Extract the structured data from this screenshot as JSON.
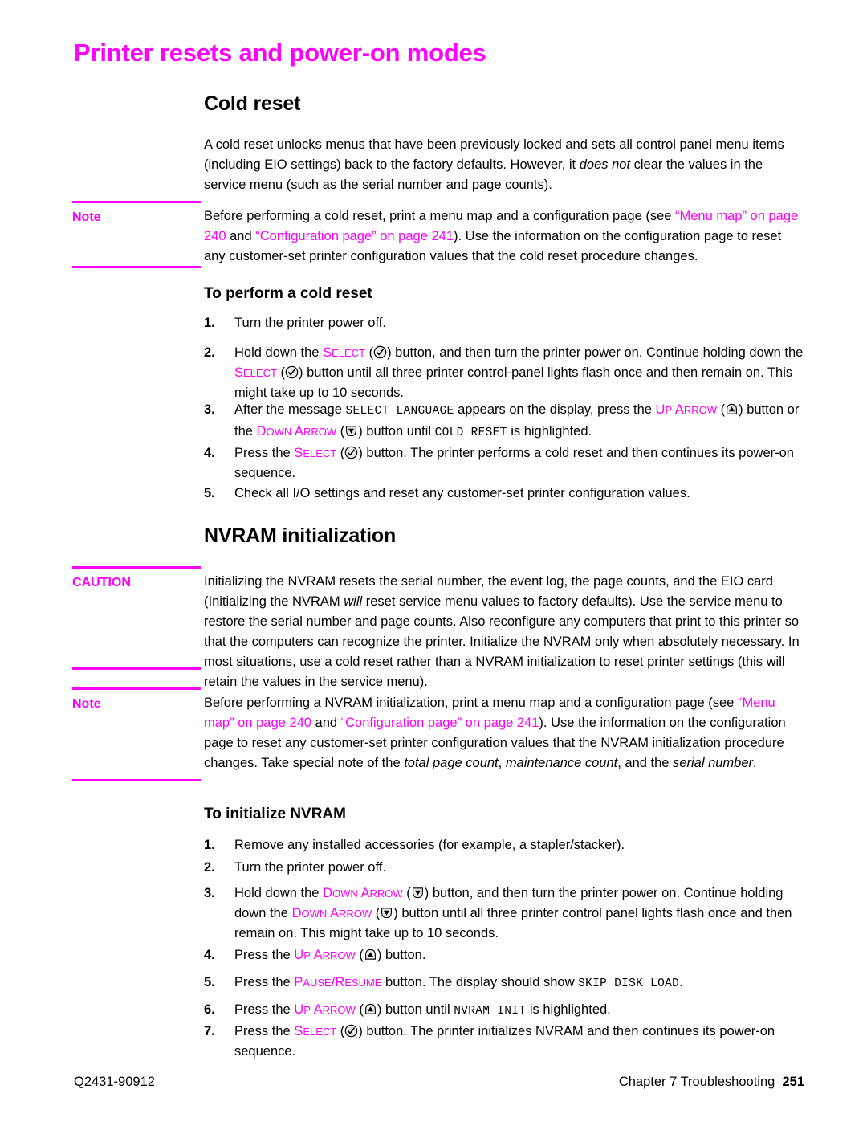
{
  "page": {
    "title": "Printer resets and power-on modes",
    "accent_color": "#ff00ff",
    "text_color": "#000000",
    "background_color": "#ffffff"
  },
  "sections": {
    "cold_reset": {
      "heading": "Cold reset",
      "intro_1": "A cold reset unlocks menus that have been previously locked and sets all control panel menu items (including EIO settings) back to the factory defaults. However, it ",
      "intro_italic": "does not",
      "intro_2": " clear the values in the service menu (such as the serial number and page counts).",
      "note": {
        "label": "Note",
        "t1": "Before performing a cold reset, print a menu map and a configuration page (see ",
        "xref1": "“Menu map” on page 240",
        "t2": " and ",
        "xref2": "“Configuration page” on page 241",
        "t3": "). Use the information on the configuration page to reset any customer-set printer configuration values that the cold reset procedure changes."
      },
      "procedure_heading": "To perform a cold reset",
      "steps": [
        {
          "num": "1.",
          "t1": "Turn the printer power off."
        },
        {
          "num": "2.",
          "t1": "Hold down the ",
          "key1": "Select",
          "icon1": "select-check-icon",
          "t2": ") button, and then turn the printer power on. Continue holding down the ",
          "key2": "Select",
          "icon2": "select-check-icon",
          "t3": ") button until all three printer control-panel lights flash once and then remain on. This might take up to 10 seconds."
        },
        {
          "num": "3.",
          "t1": "After the message ",
          "mono1": "SELECT LANGUAGE",
          "t2": " appears on the display, press the ",
          "key1": "Up Arrow",
          "icon1": "up-arrow-icon",
          "t3": ") button or the ",
          "key2": "Down Arrow",
          "icon2": "down-arrow-icon",
          "t4": ") button until ",
          "mono2": "COLD RESET",
          "t5": " is highlighted."
        },
        {
          "num": "4.",
          "t1": "Press the ",
          "key1": "Select",
          "icon1": "select-check-icon",
          "t2": ") button. The printer performs a cold reset and then continues its power-on sequence."
        },
        {
          "num": "5.",
          "t1": "Check all I/O settings and reset any customer-set printer configuration values."
        }
      ]
    },
    "nvram": {
      "heading": "NVRAM initialization",
      "caution": {
        "label": "CAUTION",
        "t1": "Initializing the NVRAM resets the serial number, the event log, the page counts, and the EIO card (Initializing the NVRAM ",
        "italic1": "will",
        "t2": " reset service menu values to factory defaults). Use the service menu to restore the serial number and page counts. Also reconfigure any computers that print to this printer so that the computers can recognize the printer. Initialize the NVRAM only when absolutely necessary. In most situations, use a cold reset rather than a NVRAM initialization to reset printer settings (this will retain the values in the service menu)."
      },
      "note": {
        "label": "Note",
        "t1": "Before performing a NVRAM initialization, print a menu map and a configuration page (see ",
        "xref1": "“Menu map” on page 240",
        "t2": " and ",
        "xref2": "“Configuration page” on page 241",
        "t3": "). Use the information on the configuration page to reset any customer-set printer configuration values that the NVRAM initialization procedure changes. Take special note of the ",
        "italic1": "total page count",
        "t4": ", ",
        "italic2": "maintenance count",
        "t5": ", and the ",
        "italic3": "serial number",
        "t6": "."
      },
      "procedure_heading": "To initialize NVRAM",
      "steps": [
        {
          "num": "1.",
          "t1": "Remove any installed accessories (for example, a stapler/stacker)."
        },
        {
          "num": "2.",
          "t1": "Turn the printer power off."
        },
        {
          "num": "3.",
          "t1": "Hold down the ",
          "key1": "Down Arrow",
          "icon1": "down-arrow-icon",
          "t2": ") button, and then turn the printer power on. Continue holding down the ",
          "key2": "Down Arrow",
          "icon2": "down-arrow-icon",
          "t3": ") button until all three printer control panel lights flash once and then remain on. This might take up to 10 seconds."
        },
        {
          "num": "4.",
          "t1": "Press the ",
          "key1": "Up Arrow",
          "icon1": "up-arrow-icon",
          "t2": ") button."
        },
        {
          "num": "5.",
          "t1": "Press the ",
          "key1": "Pause/Resume",
          "t2": " button. The display should show ",
          "mono1": "SKIP DISK LOAD",
          "t3": "."
        },
        {
          "num": "6.",
          "t1": "Press the ",
          "key1": "Up Arrow",
          "icon1": "up-arrow-icon",
          "t2": ") button until ",
          "mono1": "NVRAM INIT",
          "t3": " is highlighted."
        },
        {
          "num": "7.",
          "t1": "Press the ",
          "key1": "Select",
          "icon1": "select-check-icon",
          "t2": ") button. The printer initializes NVRAM and then continues its power-on sequence."
        }
      ]
    }
  },
  "footer": {
    "part_number": "Q2431-90912",
    "chapter": "Chapter 7 Troubleshooting",
    "page_number": "251"
  }
}
